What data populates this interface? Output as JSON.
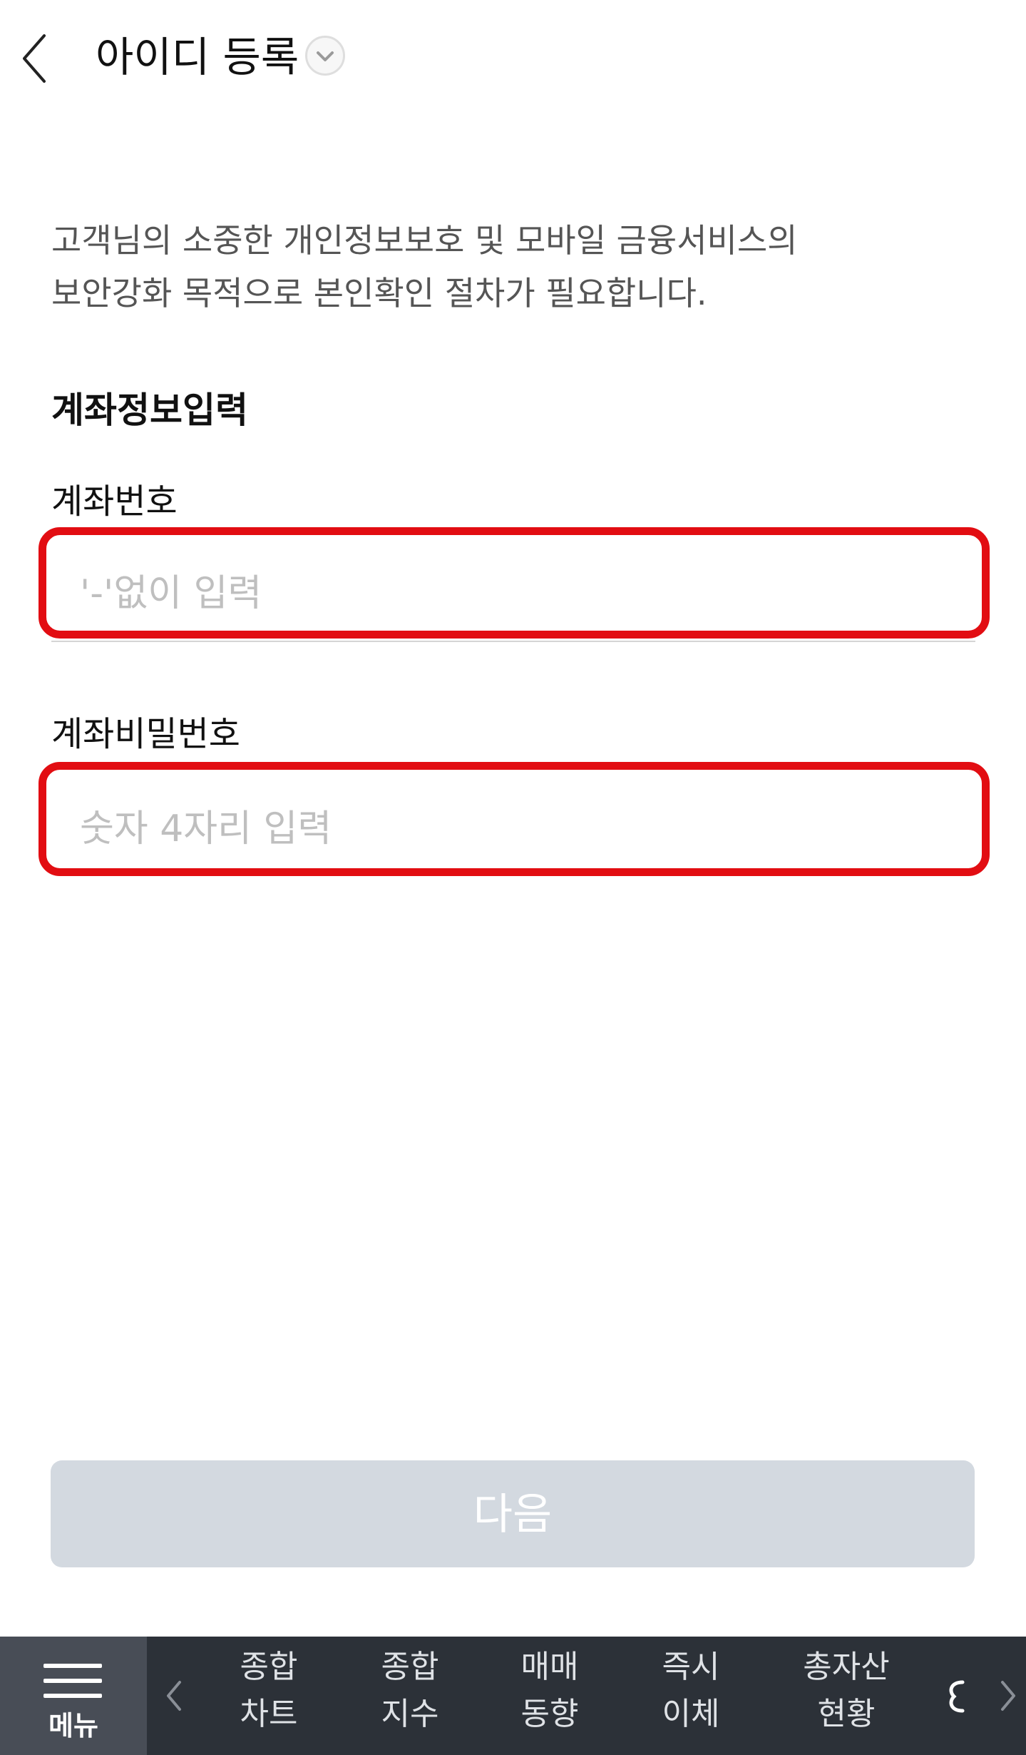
{
  "header": {
    "title": "아이디 등록",
    "back_icon": "chevron-left-icon",
    "dropdown_icon": "chevron-down-icon"
  },
  "intro": {
    "line1": "고객님의 소중한 개인정보보호 및 모바일 금융서비스의",
    "line2": "보안강화 목적으로 본인확인 절차가 필요합니다."
  },
  "section": {
    "title": "계좌정보입력"
  },
  "account_number": {
    "label": "계좌번호",
    "placeholder": "'-'없이 입력",
    "value": ""
  },
  "account_password": {
    "label": "계좌비밀번호",
    "placeholder": "숫자 4자리 입력",
    "value": ""
  },
  "next_button": {
    "label": "다음",
    "disabled": true
  },
  "bottom_nav": {
    "menu_label": "메뉴",
    "menu_icon": "hamburger-menu-icon",
    "prev_icon": "chevron-left-icon",
    "next_icon": "chevron-right-icon",
    "items": [
      {
        "line1": "종합",
        "line2": "차트"
      },
      {
        "line1": "종합",
        "line2": "지수"
      },
      {
        "line1": "매매",
        "line2": "동향"
      },
      {
        "line1": "즉시",
        "line2": "이체"
      },
      {
        "line1": "총자산",
        "line2": "현황"
      }
    ]
  },
  "colors": {
    "highlight": "#e20d12",
    "button_disabled_bg": "#d3d9e0",
    "nav_bg": "#2c3138",
    "menu_bg": "#484d56",
    "placeholder": "#bfbfbf"
  }
}
